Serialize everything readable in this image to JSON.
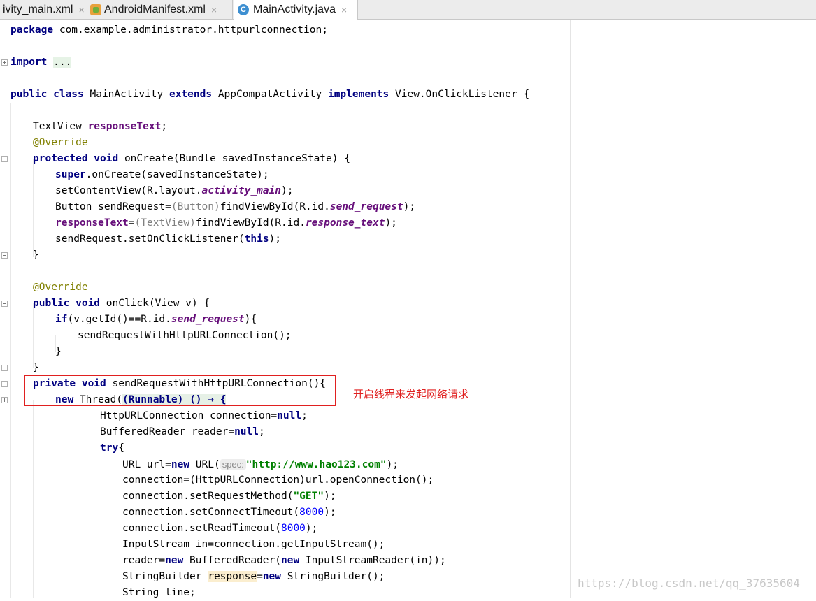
{
  "tabs": [
    {
      "label": "ivity_main.xml",
      "icon": "none",
      "close": "×"
    },
    {
      "label": "AndroidManifest.xml",
      "icon": "xml-file-icon",
      "close": "×"
    },
    {
      "label": "MainActivity.java",
      "icon": "java-class-icon",
      "icon_letter": "C",
      "close": "×",
      "active": true
    }
  ],
  "code": {
    "l1": {
      "kw": "package",
      "rest": " com.example.administrator.httpurlconnection;"
    },
    "l3": {
      "kw": "import",
      "fold": "..."
    },
    "l5": {
      "kw1": "public class",
      "t1": " MainActivity ",
      "kw2": "extends",
      "t2": " AppCompatActivity ",
      "kw3": "implements",
      "t3": " View.OnClickListener {"
    },
    "l7": {
      "t1": "TextView ",
      "fld": "responseText",
      "t2": ";"
    },
    "l8": {
      "ann": "@Override"
    },
    "l9": {
      "kw": "protected void",
      "t": " onCreate(Bundle savedInstanceState) {"
    },
    "l10": {
      "kw": "super",
      "t": ".onCreate(savedInstanceState);"
    },
    "l11": {
      "t1": "setContentView(R.layout.",
      "ifld": "activity_main",
      "t2": ");"
    },
    "l12": {
      "t1": "Button sendRequest=",
      "cast": "(Button)",
      "t2": "findViewById(R.id.",
      "ifld": "send_request",
      "t3": ");"
    },
    "l13": {
      "fld": "responseText",
      "t1": "=",
      "cast": "(TextView)",
      "t2": "findViewById(R.id.",
      "ifld": "response_text",
      "t3": ");"
    },
    "l14": {
      "t1": "sendRequest.setOnClickListener(",
      "kw": "this",
      "t2": ");"
    },
    "l15": {
      "t": "}"
    },
    "l17": {
      "ann": "@Override"
    },
    "l18": {
      "kw": "public void",
      "t": " onClick(View v) {"
    },
    "l19": {
      "kw": "if",
      "t1": "(v.getId()==R.id.",
      "ifld": "send_request",
      "t2": "){"
    },
    "l20": {
      "t": "sendRequestWithHttpURLConnection();"
    },
    "l21": {
      "t": "}"
    },
    "l22": {
      "t": "}"
    },
    "l23": {
      "kw": "private void",
      "t": " sendRequestWithHttpURLConnection(){"
    },
    "l24": {
      "kw": "new",
      "t1": " Thread(",
      "lambda": "(Runnable) () → {"
    },
    "l25": {
      "t1": "HttpURLConnection connection=",
      "kw": "null",
      "t2": ";"
    },
    "l26": {
      "t1": "BufferedReader reader=",
      "kw": "null",
      "t2": ";"
    },
    "l27": {
      "kw": "try",
      "t": "{"
    },
    "l28": {
      "t1": "URL url=",
      "kw": "new",
      "t2": " URL(",
      "hint": "spec:",
      "str": "\"http://www.hao123.com\"",
      "t3": ");"
    },
    "l29": {
      "t": "connection=(HttpURLConnection)url.openConnection();"
    },
    "l30": {
      "t1": "connection.setRequestMethod(",
      "str": "\"GET\"",
      "t2": ");"
    },
    "l31": {
      "t1": "connection.setConnectTimeout(",
      "num": "8000",
      "t2": ");"
    },
    "l32": {
      "t1": "connection.setReadTimeout(",
      "num": "8000",
      "t2": ");"
    },
    "l33": {
      "t": "InputStream in=connection.getInputStream();"
    },
    "l34": {
      "t1": "reader=",
      "kw1": "new",
      "t2": " BufferedReader(",
      "kw2": "new",
      "t3": " InputStreamReader(in));"
    },
    "l35": {
      "t1": "StringBuilder ",
      "hl": "response",
      "t2": "=",
      "kw": "new",
      "t3": " StringBuilder();"
    },
    "l36": {
      "t": "String line;"
    }
  },
  "annotation_note": "开启线程来发起网络请求",
  "watermark": "https://blog.csdn.net/qq_37635604"
}
